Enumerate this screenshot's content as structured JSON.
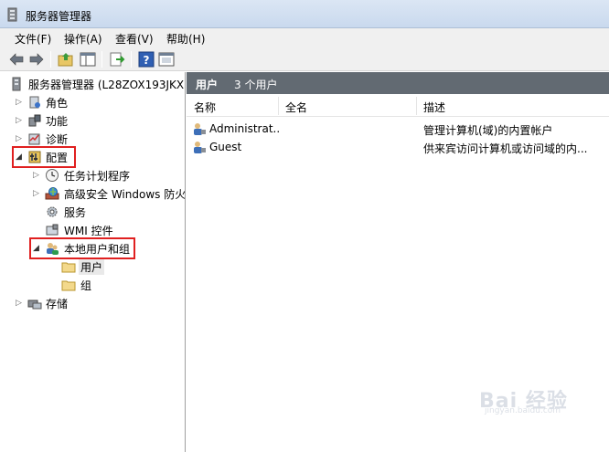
{
  "window": {
    "title": "服务器管理器"
  },
  "menu": [
    "文件(F)",
    "操作(A)",
    "查看(V)",
    "帮助(H)"
  ],
  "toolbar": {
    "buttons": [
      "back-icon",
      "forward-icon",
      "up-folder-icon",
      "show-hide-tree-icon",
      "export-list-icon",
      "help-icon",
      "properties-icon"
    ]
  },
  "tree": {
    "root": "服务器管理器 (L28ZOX193JKX",
    "roles": "角色",
    "features": "功能",
    "diagnostics": "诊断",
    "configuration": "配置",
    "task_scheduler": "任务计划程序",
    "firewall": "高级安全 Windows 防火",
    "services": "服务",
    "wmi": "WMI 控件",
    "local_users": "本地用户和组",
    "users": "用户",
    "groups": "组",
    "storage": "存储"
  },
  "panel": {
    "title": "用户",
    "count": "3 个用户",
    "columns": [
      "名称",
      "全名",
      "描述"
    ],
    "rows": [
      {
        "name": "Administrat...",
        "fullname": "",
        "description": "管理计算机(域)的内置帐户"
      },
      {
        "name": "Guest",
        "fullname": "",
        "description": "供来宾访问计算机或访问域的内..."
      }
    ]
  },
  "watermark": {
    "logo": "Bai 经验",
    "url": "jingyan.baidu.com"
  },
  "colors": {
    "highlight": "#e02020",
    "header_bar": "#626a72",
    "title_gradient": "#dbe6f4"
  }
}
